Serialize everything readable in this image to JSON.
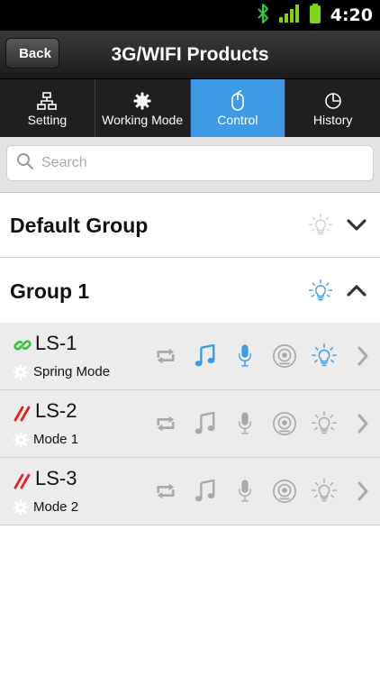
{
  "status_bar": {
    "time": "4:20"
  },
  "nav": {
    "back_label": "Back",
    "title": "3G/WIFI Products"
  },
  "tabs": [
    {
      "label": "Setting",
      "icon": "sitemap-icon"
    },
    {
      "label": "Working Mode",
      "icon": "gear-icon"
    },
    {
      "label": "Control",
      "icon": "mouse-icon",
      "active": true
    },
    {
      "label": "History",
      "icon": "pie-chart-icon"
    }
  ],
  "search": {
    "placeholder": "Search"
  },
  "groups": [
    {
      "title": "Default Group",
      "light_on": false,
      "expanded": false
    },
    {
      "title": "Group 1",
      "light_on": true,
      "expanded": true
    }
  ],
  "devices": [
    {
      "name": "LS-1",
      "mode": "Spring Mode",
      "connected": true,
      "music": true,
      "mic": true,
      "light": true
    },
    {
      "name": "LS-2",
      "mode": "Mode 1",
      "connected": false,
      "music": false,
      "mic": false,
      "light": false
    },
    {
      "name": "LS-3",
      "mode": "Mode 2",
      "connected": false,
      "music": false,
      "mic": false,
      "light": false
    }
  ],
  "colors": {
    "accent": "#3f9ae6",
    "connected": "#3bbf3b",
    "disconnected": "#e02424",
    "inactive": "#a9a9a9"
  }
}
